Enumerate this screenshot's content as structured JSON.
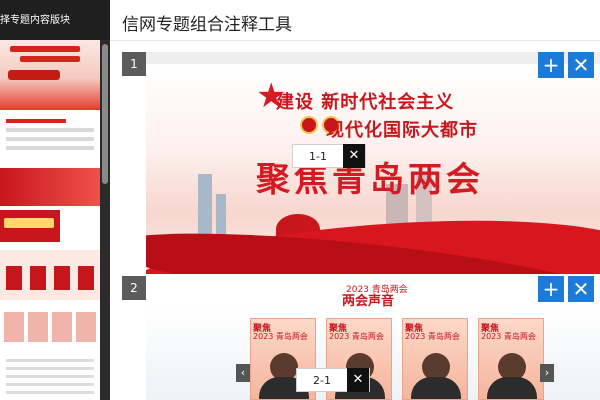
{
  "left_panel": {
    "header": "择专题内容版块"
  },
  "main": {
    "title": "信网专题组合注释工具",
    "blocks": [
      {
        "index": "1",
        "add_label": "+",
        "remove_label": "✕",
        "annotation": {
          "label": "1-1",
          "close": "✕"
        },
        "banner": {
          "headline1": "建设  新时代社会主义",
          "headline2": "现代化国际大都市",
          "calligraphy": "聚焦青岛两会"
        }
      },
      {
        "index": "2",
        "add_label": "+",
        "remove_label": "✕",
        "annotation": {
          "label": "2-1",
          "close": "✕"
        },
        "section": {
          "sub": "2023 青岛两会",
          "title": "两会声音"
        },
        "cards": [
          {
            "head": "聚焦",
            "sub": "2023 青岛两会"
          },
          {
            "head": "聚焦",
            "sub": "2023 青岛两会"
          },
          {
            "head": "聚焦",
            "sub": "2023 青岛两会"
          },
          {
            "head": "聚焦",
            "sub": "2023 青岛两会"
          }
        ],
        "prev_arrow": "‹",
        "next_arrow": "›"
      }
    ]
  },
  "colors": {
    "accent_blue": "#1d7ad6",
    "brand_red": "#c8161d",
    "panel_dark": "#1f1f1f"
  }
}
